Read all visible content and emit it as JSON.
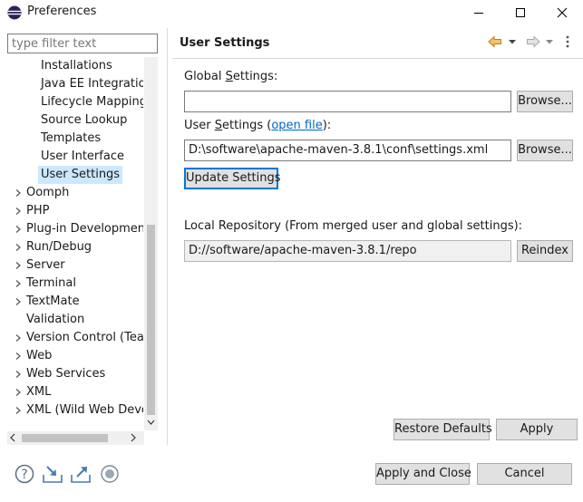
{
  "window": {
    "title": "Preferences"
  },
  "filter": {
    "placeholder": "type filter text"
  },
  "tree": {
    "items": [
      {
        "label": "Installations",
        "level": 1,
        "expandable": false,
        "selected": false
      },
      {
        "label": "Java EE Integration",
        "level": 1,
        "expandable": false,
        "selected": false
      },
      {
        "label": "Lifecycle Mappings",
        "level": 1,
        "expandable": false,
        "selected": false
      },
      {
        "label": "Source Lookup",
        "level": 1,
        "expandable": false,
        "selected": false
      },
      {
        "label": "Templates",
        "level": 1,
        "expandable": false,
        "selected": false
      },
      {
        "label": "User Interface",
        "level": 1,
        "expandable": false,
        "selected": false
      },
      {
        "label": "User Settings",
        "level": 1,
        "expandable": false,
        "selected": true
      },
      {
        "label": "Oomph",
        "level": 0,
        "expandable": true,
        "selected": false
      },
      {
        "label": "PHP",
        "level": 0,
        "expandable": true,
        "selected": false
      },
      {
        "label": "Plug-in Development",
        "level": 0,
        "expandable": true,
        "selected": false
      },
      {
        "label": "Run/Debug",
        "level": 0,
        "expandable": true,
        "selected": false
      },
      {
        "label": "Server",
        "level": 0,
        "expandable": true,
        "selected": false
      },
      {
        "label": "Terminal",
        "level": 0,
        "expandable": true,
        "selected": false
      },
      {
        "label": "TextMate",
        "level": 0,
        "expandable": true,
        "selected": false
      },
      {
        "label": "Validation",
        "level": 0,
        "expandable": false,
        "selected": false
      },
      {
        "label": "Version Control (Team)",
        "level": 0,
        "expandable": true,
        "selected": false
      },
      {
        "label": "Web",
        "level": 0,
        "expandable": true,
        "selected": false
      },
      {
        "label": "Web Services",
        "level": 0,
        "expandable": true,
        "selected": false
      },
      {
        "label": "XML",
        "level": 0,
        "expandable": true,
        "selected": false
      },
      {
        "label": "XML (Wild Web Developer)",
        "level": 0,
        "expandable": true,
        "selected": false
      }
    ]
  },
  "page": {
    "title": "User Settings",
    "global_label_pre": "Global ",
    "global_label_key": "S",
    "global_label_post": "ettings:",
    "global_value": "",
    "browse_label": "Browse...",
    "user_label_pre": "User ",
    "user_label_key": "S",
    "user_label_post": "ettings (",
    "user_label_link": "open file",
    "user_label_end": "):",
    "user_value": "D:\\software\\apache-maven-3.8.1\\conf\\settings.xml",
    "update_label": "Update Settings",
    "local_repo_label": "Local Repository (From merged user and global settings):",
    "local_repo_value": "D://software/apache-maven-3.8.1/repo",
    "reindex_label": "Reindex",
    "restore_defaults_label": "Restore Defaults",
    "apply_label": "Apply"
  },
  "footer": {
    "apply_close_label": "Apply and Close",
    "cancel_label": "Cancel"
  },
  "colors": {
    "accent": "#0078d7",
    "selection": "#cce8ff",
    "link": "#0066cc",
    "nav_arrow": "#e8a33a"
  }
}
